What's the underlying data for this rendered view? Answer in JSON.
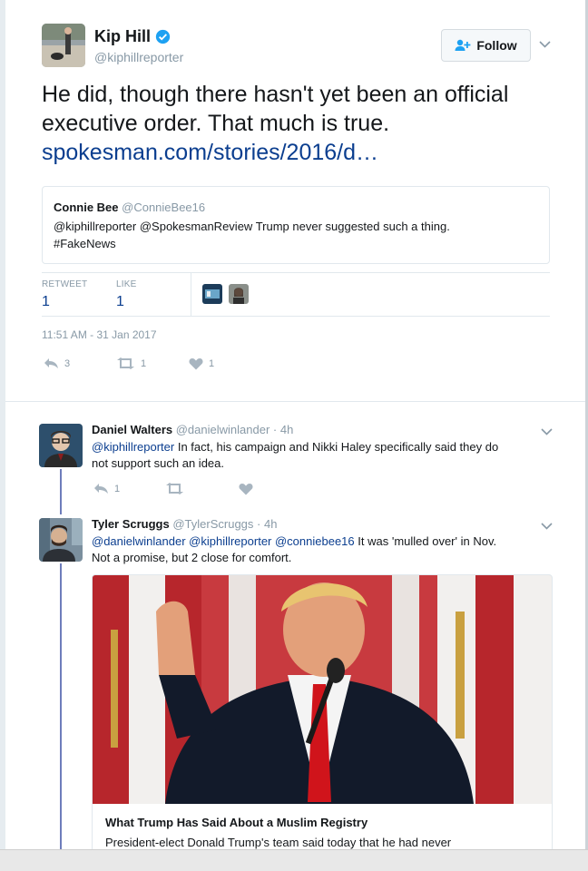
{
  "main_tweet": {
    "author_name": "Kip Hill",
    "author_handle": "@kiphillreporter",
    "follow_label": "Follow",
    "text": "He did, though there hasn't yet been an official executive order. That much is true.",
    "link_text": "spokesman.com/stories/2016/d…",
    "quote": {
      "name": "Connie Bee",
      "handle": "@ConnieBee16",
      "text_line1": "@kiphillreporter @SpokesmanReview Trump never suggested such a thing.",
      "text_line2": "#FakeNews"
    },
    "retweets_label": "RETWEET",
    "retweets_value": "1",
    "likes_label": "LIKE",
    "likes_value": "1",
    "timestamp": "11:51 AM - 31 Jan 2017",
    "reply_count": "3",
    "retweet_count": "1",
    "like_count": "1"
  },
  "replies": [
    {
      "name": "Daniel Walters",
      "handle": "@danielwinlander",
      "time": "· 4h",
      "mention": "@kiphillreporter",
      "text": " In fact, his campaign and Nikki Haley specifically said they do",
      "text2": "not support such an idea.",
      "reply_count": "1"
    },
    {
      "name": "Tyler Scruggs",
      "handle": "@TylerScruggs",
      "time": "· 4h",
      "mentions": "@danielwinlander @kiphillreporter @conniebee16",
      "text": " It was 'mulled over' in Nov.",
      "text2": "Not a promise, but 2 close for comfort.",
      "card_title": "What Trump Has Said About a Muslim Registry",
      "card_desc": "President-elect Donald Trump's team said today that he had never"
    }
  ],
  "colors": {
    "link": "#0b3e8f",
    "thread_line": "#6e7dbb",
    "verified": "#1da1f2"
  },
  "icons": [
    "verified-badge-icon",
    "follow-person-icon",
    "chevron-down-icon",
    "reply-icon",
    "retweet-icon",
    "heart-icon"
  ]
}
